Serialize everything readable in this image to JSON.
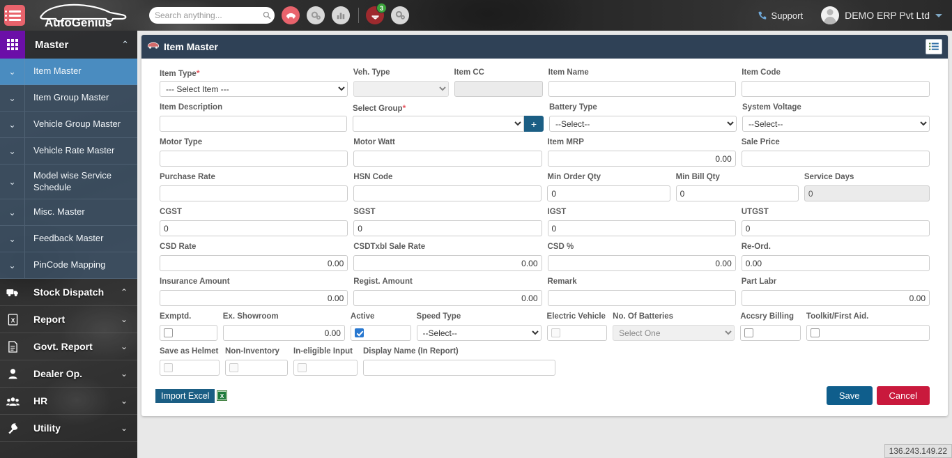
{
  "topbar": {
    "menu_icon": "hamburger-icon",
    "brand": "AutoGenius",
    "search": {
      "placeholder": "Search anything...",
      "value": ""
    },
    "quick_icons": [
      {
        "name": "car-icon",
        "style": "red"
      },
      {
        "name": "gears-icon",
        "style": "gray"
      },
      {
        "name": "chart-icon",
        "style": "gray"
      }
    ],
    "notification": {
      "name": "notification-icon",
      "badge": "3"
    },
    "settings_icon": "gears-settings-icon",
    "support_label": "Support",
    "support_icon": "phone-icon",
    "user_name": "DEMO ERP Pvt Ltd",
    "user_avatar": "avatar-icon",
    "user_caret": "chevron-down-icon"
  },
  "sidebar": {
    "header": {
      "label": "Master",
      "icon": "grid-icon",
      "chevron": "⌃"
    },
    "sub_items": [
      {
        "label": "Item Master",
        "active": true
      },
      {
        "label": "Item Group Master",
        "active": false
      },
      {
        "label": "Vehicle Group Master",
        "active": false
      },
      {
        "label": "Vehicle Rate Master",
        "active": false
      },
      {
        "label": "Model wise Service Schedule",
        "active": false
      },
      {
        "label": "Misc. Master",
        "active": false
      },
      {
        "label": "Feedback Master",
        "active": false
      },
      {
        "label": "PinCode Mapping",
        "active": false
      }
    ],
    "main_items": [
      {
        "label": "Stock Dispatch",
        "icon": "truck-icon",
        "chevron": "⌃"
      },
      {
        "label": "Report",
        "icon": "excel-report-icon",
        "chevron": "⌄"
      },
      {
        "label": "Govt. Report",
        "icon": "document-icon",
        "chevron": "⌄"
      },
      {
        "label": "Dealer Op.",
        "icon": "user-icon",
        "chevron": "⌄"
      },
      {
        "label": "HR",
        "icon": "people-icon",
        "chevron": "⌄"
      },
      {
        "label": "Utility",
        "icon": "wrench-icon",
        "chevron": "⌄"
      }
    ]
  },
  "panel": {
    "title": "Item Master",
    "title_icon": "car-icon",
    "list_button_icon": "list-view-icon"
  },
  "form": {
    "item_type": {
      "label": "Item Type",
      "required": true,
      "value": "--- Select Item ---"
    },
    "veh_type": {
      "label": "Veh. Type",
      "value": "",
      "disabled": true
    },
    "item_cc": {
      "label": "Item CC",
      "value": "",
      "disabled": true
    },
    "item_name": {
      "label": "Item Name",
      "value": ""
    },
    "item_code": {
      "label": "Item Code",
      "value": ""
    },
    "item_description": {
      "label": "Item Description",
      "value": ""
    },
    "select_group": {
      "label": "Select Group",
      "required": true,
      "value": "",
      "add_button": "+"
    },
    "battery_type": {
      "label": "Battery Type",
      "value": "--Select--"
    },
    "system_voltage": {
      "label": "System Voltage",
      "value": "--Select--"
    },
    "motor_type": {
      "label": "Motor Type",
      "value": ""
    },
    "motor_watt": {
      "label": "Motor Watt",
      "value": ""
    },
    "item_mrp": {
      "label": "Item MRP",
      "value": "0.00"
    },
    "sale_price": {
      "label": "Sale Price",
      "value": ""
    },
    "purchase_rate": {
      "label": "Purchase Rate",
      "value": ""
    },
    "hsn_code": {
      "label": "HSN Code",
      "value": ""
    },
    "min_order_qty": {
      "label": "Min Order Qty",
      "value": "0"
    },
    "min_bill_qty": {
      "label": "Min Bill Qty",
      "value": "0"
    },
    "service_days": {
      "label": "Service Days",
      "value": "0",
      "disabled": true
    },
    "cgst": {
      "label": "CGST",
      "value": "0"
    },
    "sgst": {
      "label": "SGST",
      "value": "0"
    },
    "igst": {
      "label": "IGST",
      "value": "0"
    },
    "utgst": {
      "label": "UTGST",
      "value": "0"
    },
    "csd_rate": {
      "label": "CSD Rate",
      "value": "0.00"
    },
    "csd_txbl_sale_rate": {
      "label": "CSDTxbl Sale Rate",
      "value": "0.00"
    },
    "csd_percent": {
      "label": "CSD %",
      "value": "0.00"
    },
    "re_ord": {
      "label": "Re-Ord.",
      "value": "0.00"
    },
    "insurance_amount": {
      "label": "Insurance Amount",
      "value": "0.00"
    },
    "regist_amount": {
      "label": "Regist. Amount",
      "value": "0.00"
    },
    "remark": {
      "label": "Remark",
      "value": ""
    },
    "part_labr": {
      "label": "Part Labr",
      "value": "0.00"
    },
    "exmptd": {
      "label": "Exmptd.",
      "checked": false
    },
    "ex_showroom": {
      "label": "Ex. Showroom",
      "value": "0.00"
    },
    "active": {
      "label": "Active",
      "checked": true
    },
    "speed_type": {
      "label": "Speed Type",
      "value": "--Select--"
    },
    "electric_vehicle": {
      "label": "Electric Vehicle",
      "checked": false,
      "disabled": true
    },
    "no_of_batteries": {
      "label": "No. Of Batteries",
      "value": "Select One",
      "disabled": true
    },
    "accsry_billing": {
      "label": "Accsry Billing",
      "checked": false
    },
    "toolkit_first_aid": {
      "label": "Toolkit/First Aid.",
      "checked": false
    },
    "save_as_helmet": {
      "label": "Save as Helmet",
      "checked": false,
      "disabled": true
    },
    "non_inventory": {
      "label": "Non-Inventory",
      "checked": false,
      "disabled": true
    },
    "in_eligible_input": {
      "label": "In-eligible Input",
      "checked": false,
      "disabled": true
    },
    "display_name": {
      "label": "Display Name (In Report)",
      "value": ""
    }
  },
  "actions": {
    "import_excel": "Import Excel",
    "excel_icon": "excel-file-icon",
    "save": "Save",
    "cancel": "Cancel"
  },
  "status": {
    "ip_address": "136.243.149.22"
  },
  "colors": {
    "accent_blue": "#1b5e84",
    "panel_header": "#2f4156",
    "save": "#0f5e8c",
    "cancel": "#c9193c",
    "sidebar_active": "#4a8cc0",
    "brand_red": "#e8636c",
    "badge_green": "#3aa33a",
    "purple": "#6b0fa8"
  }
}
